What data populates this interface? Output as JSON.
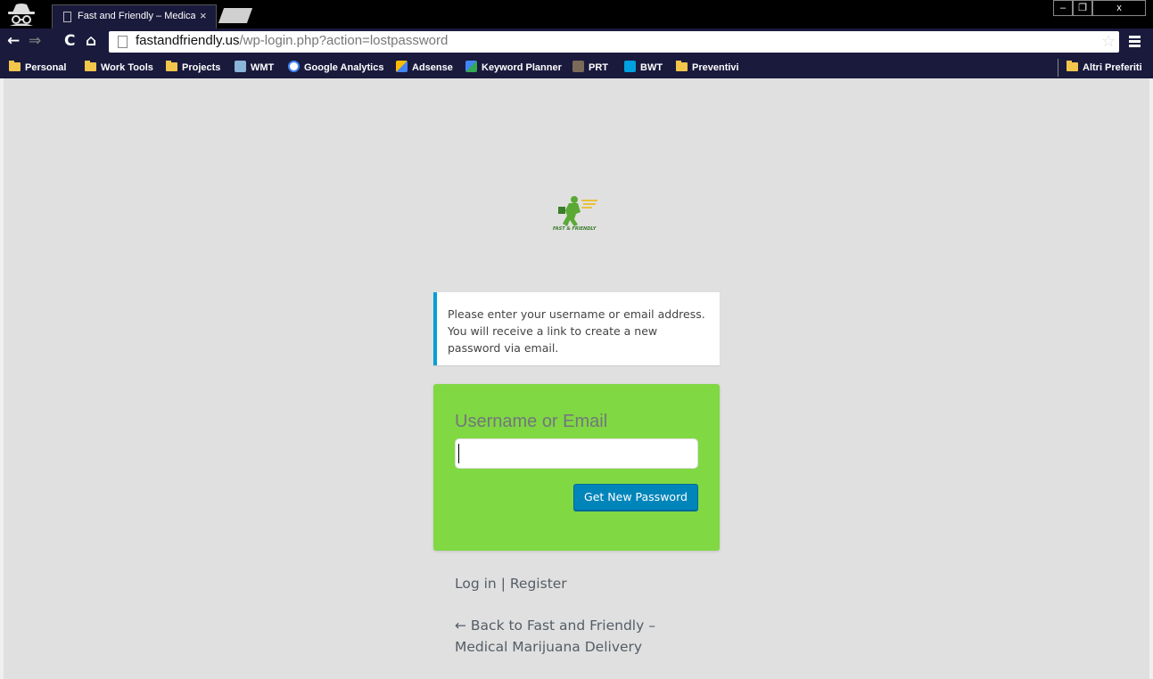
{
  "browser": {
    "tab_title": "Fast and Friendly – Medical Marijuana Delivery",
    "tab_close": "×",
    "window_controls": [
      "–",
      "❐",
      "x"
    ],
    "url_host": "fastandfriendly.us",
    "url_path": "/wp-login.php?action=lostpassword",
    "bookmarks": [
      {
        "label": "Personal",
        "icon": "folder-icon"
      },
      {
        "label": "Work Tools",
        "icon": "folder-icon"
      },
      {
        "label": "Projects",
        "icon": "folder-icon"
      },
      {
        "label": "WMT",
        "icon": "webmaster-tools-icon"
      },
      {
        "label": "Google Analytics",
        "icon": "google-icon"
      },
      {
        "label": "Adsense",
        "icon": "adsense-icon"
      },
      {
        "label": "Keyword Planner",
        "icon": "adwords-icon"
      },
      {
        "label": "PRT",
        "icon": "prt-icon"
      },
      {
        "label": "BWT",
        "icon": "bing-icon"
      },
      {
        "label": "Preventivi",
        "icon": "folder-icon"
      }
    ],
    "other_bookmarks": "Altri Preferiti"
  },
  "page": {
    "logo_text": "FAST & FRIENDLY",
    "message": "Please enter your username or email address. You will receive a link to create a new password via email.",
    "form": {
      "label": "Username or Email",
      "input_value": "",
      "submit_label": "Get New Password"
    },
    "nav": {
      "login": "Log in",
      "separator": "|",
      "register": "Register"
    },
    "back_link": "← Back to Fast and Friendly – Medical Marijuana Delivery"
  },
  "colors": {
    "page_bg": "#e0e0e0",
    "form_bg": "#80d843",
    "message_accent": "#00a0d2",
    "button": "#0085ba"
  }
}
